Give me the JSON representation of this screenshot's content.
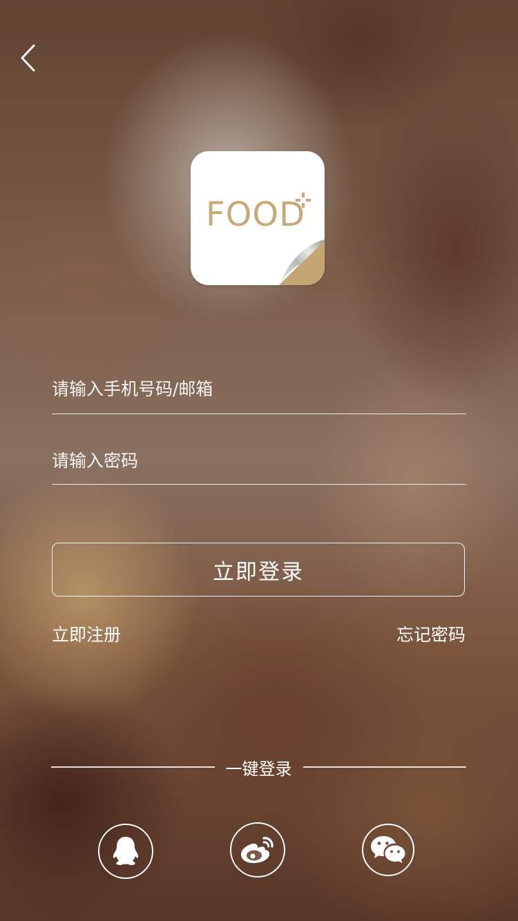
{
  "colors": {
    "brand_gold": "#c9a978",
    "text": "#ffffff"
  },
  "logo": {
    "text": "FOOD",
    "icon": "food-plus-logo-icon"
  },
  "back": {
    "icon": "chevron-left-icon"
  },
  "form": {
    "phone_placeholder": "请输入手机号码/邮箱",
    "password_placeholder": "请输入密码",
    "phone_value": "",
    "password_value": ""
  },
  "actions": {
    "login_label": "立即登录",
    "register_label": "立即注册",
    "forgot_label": "忘记密码"
  },
  "quick_login": {
    "label": "一键登录",
    "providers": [
      {
        "name": "QQ",
        "icon": "qq-icon"
      },
      {
        "name": "Weibo",
        "icon": "weibo-icon"
      },
      {
        "name": "WeChat",
        "icon": "wechat-icon"
      }
    ]
  }
}
